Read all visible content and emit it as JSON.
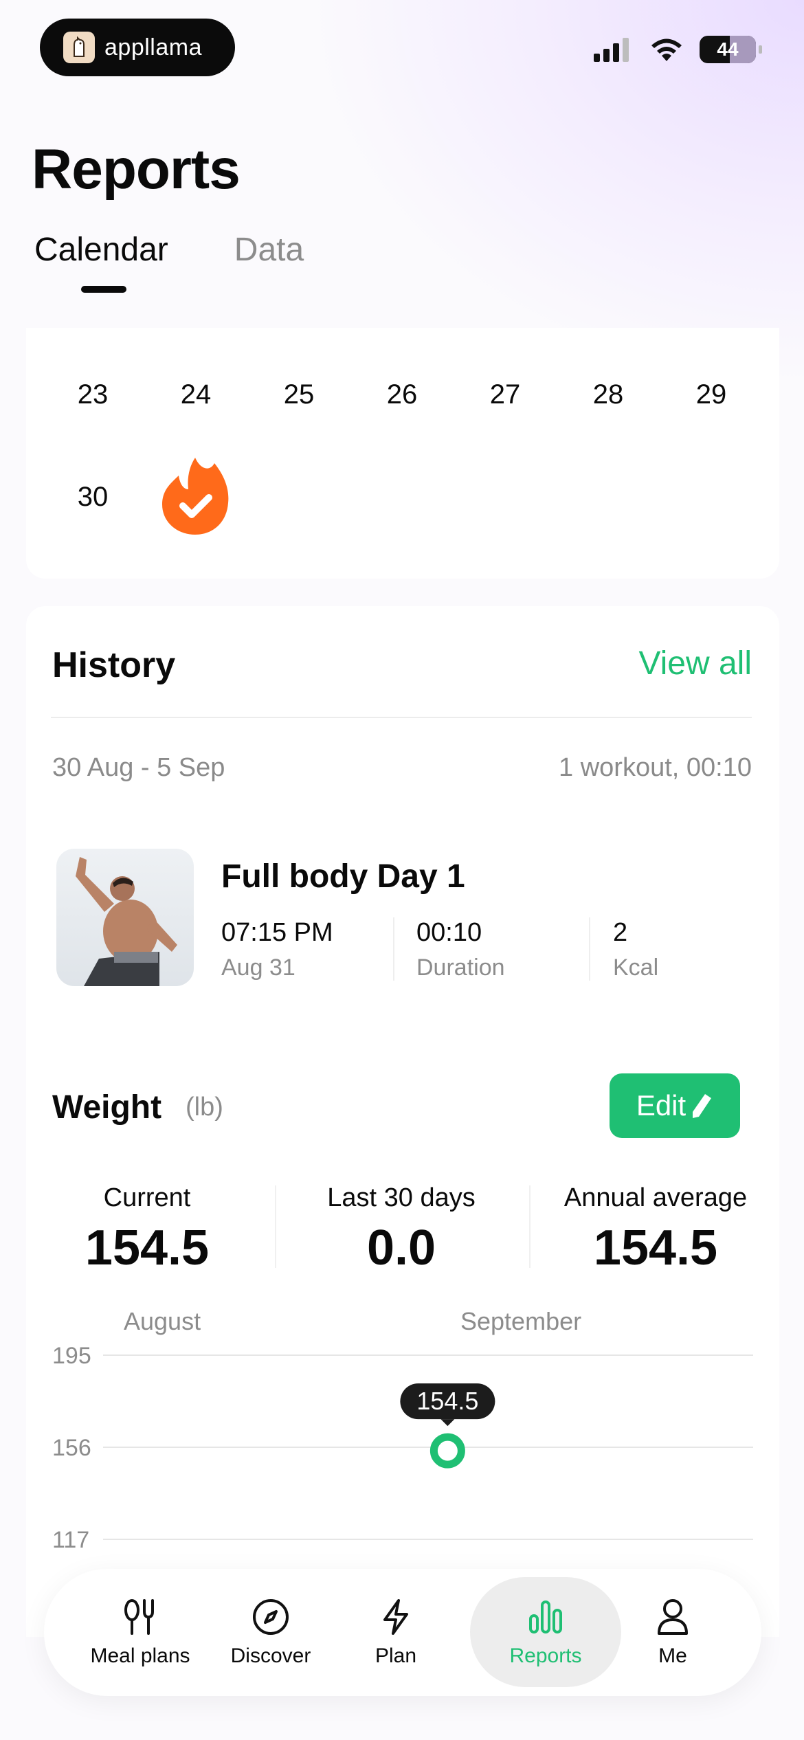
{
  "status_bar": {
    "app_name": "appllama",
    "battery": "44"
  },
  "page": {
    "title": "Reports"
  },
  "tabs": [
    {
      "label": "Calendar",
      "active": true
    },
    {
      "label": "Data",
      "active": false
    }
  ],
  "calendar": {
    "week1": [
      "23",
      "24",
      "25",
      "26",
      "27",
      "28",
      "29"
    ],
    "week2": [
      "30"
    ],
    "streak_icon": "flame-check-icon"
  },
  "history": {
    "title": "History",
    "view_all": "View all",
    "range": "30 Aug - 5 Sep",
    "summary": "1 workout, 00:10",
    "workout": {
      "title": "Full body Day 1",
      "time": "07:15 PM",
      "date": "Aug 31",
      "duration": "00:10",
      "duration_label": "Duration",
      "kcal": "2",
      "kcal_label": "Kcal"
    }
  },
  "weight": {
    "title": "Weight",
    "unit": "(lb)",
    "edit_label": "Edit",
    "stats": [
      {
        "label": "Current",
        "value": "154.5"
      },
      {
        "label": "Last 30 days",
        "value": "0.0"
      },
      {
        "label": "Annual average",
        "value": "154.5"
      }
    ],
    "months": [
      "August",
      "September"
    ],
    "tooltip": "154.5"
  },
  "chart_data": {
    "type": "line",
    "x_labels": [
      "August",
      "September"
    ],
    "y_ticks": [
      195,
      156,
      117
    ],
    "points": [
      {
        "x": "September",
        "y": 154.5
      }
    ],
    "series": [
      {
        "values": [
          154.5
        ]
      }
    ],
    "grid": true,
    "accent": "#1fbf73"
  },
  "nav": {
    "items": [
      {
        "label": "Meal plans",
        "icon": "meal-plans-icon"
      },
      {
        "label": "Discover",
        "icon": "compass-icon"
      },
      {
        "label": "Plan",
        "icon": "lightning-icon"
      },
      {
        "label": "Reports",
        "icon": "bar-chart-icon",
        "active": true
      },
      {
        "label": "Me",
        "icon": "person-icon"
      }
    ]
  },
  "colors": {
    "accent": "#1fbf73",
    "streak": "#ff6a1a"
  }
}
